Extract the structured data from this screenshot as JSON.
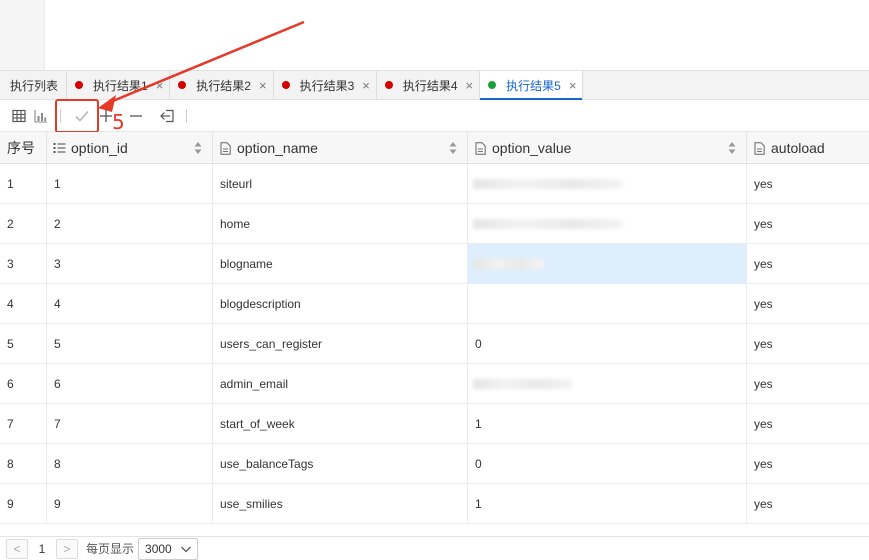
{
  "tabs": [
    {
      "label": "执行列表",
      "dot": "",
      "closable": false,
      "active": false
    },
    {
      "label": "执行结果1",
      "dot": "#d40000",
      "closable": true,
      "active": false
    },
    {
      "label": "执行结果2",
      "dot": "#d40000",
      "closable": true,
      "active": false
    },
    {
      "label": "执行结果3",
      "dot": "#d40000",
      "closable": true,
      "active": false
    },
    {
      "label": "执行结果4",
      "dot": "#d40000",
      "closable": true,
      "active": false
    },
    {
      "label": "执行结果5",
      "dot": "#1a9f3a",
      "closable": true,
      "active": true
    }
  ],
  "close_glyph": "×",
  "annotation": {
    "label": "5",
    "color": "#e53a2a"
  },
  "toolbar": {
    "icons": [
      "grid-view-icon",
      "chart-view-icon",
      "check-icon",
      "plus-icon",
      "minus-icon",
      "exit-icon"
    ]
  },
  "columns": [
    "序号",
    "option_id",
    "option_name",
    "option_value",
    "autoload"
  ],
  "rows": [
    {
      "idx": "1",
      "id": "1",
      "name": "siteurl",
      "value": "",
      "autoload": "yes",
      "value_redacted": true
    },
    {
      "idx": "2",
      "id": "2",
      "name": "home",
      "value": "",
      "autoload": "yes",
      "value_redacted": true
    },
    {
      "idx": "3",
      "id": "3",
      "name": "blogname",
      "value": "",
      "autoload": "yes",
      "value_redacted": true
    },
    {
      "idx": "4",
      "id": "4",
      "name": "blogdescription",
      "value": "",
      "autoload": "yes",
      "value_redacted": false
    },
    {
      "idx": "5",
      "id": "5",
      "name": "users_can_register",
      "value": "0",
      "autoload": "yes",
      "value_redacted": false
    },
    {
      "idx": "6",
      "id": "6",
      "name": "admin_email",
      "value": "",
      "autoload": "yes",
      "value_redacted": true
    },
    {
      "idx": "7",
      "id": "7",
      "name": "start_of_week",
      "value": "1",
      "autoload": "yes",
      "value_redacted": false
    },
    {
      "idx": "8",
      "id": "8",
      "name": "use_balanceTags",
      "value": "0",
      "autoload": "yes",
      "value_redacted": false
    },
    {
      "idx": "9",
      "id": "9",
      "name": "use_smilies",
      "value": "1",
      "autoload": "yes",
      "value_redacted": false
    }
  ],
  "selected_row": 2,
  "footer": {
    "prev": "<",
    "page": "1",
    "next": ">",
    "per_page_label": "每页显示",
    "per_page_value": "3000"
  }
}
